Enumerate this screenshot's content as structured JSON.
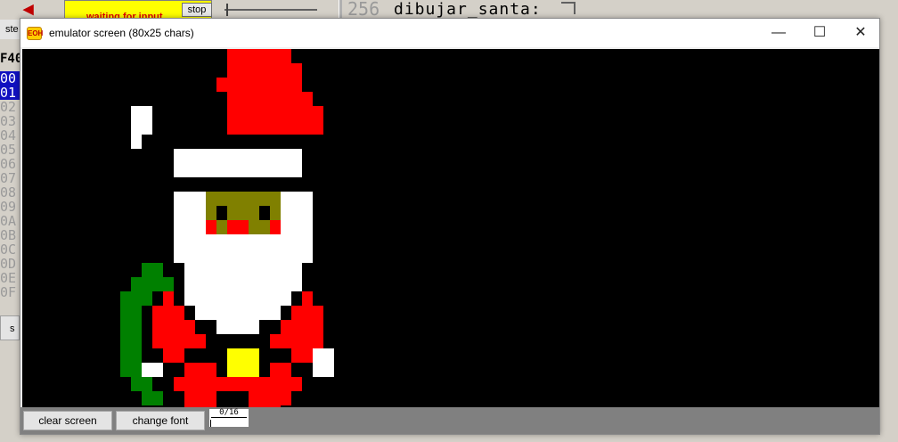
{
  "bg_app": {
    "status_text": "waiting for input",
    "stop_label": "stop",
    "line_number": "256",
    "code_label": "dibujar_santa:",
    "step_label": "ste",
    "mem_header": "F40",
    "mem_rows": [
      "00",
      "01",
      "02",
      "03",
      "04",
      "05",
      "06",
      "07",
      "08",
      "09",
      "0A",
      "0B",
      "0C",
      "0D",
      "0E",
      "0F"
    ],
    "bottom_left_label": "s"
  },
  "window": {
    "title": "emulator screen (80x25 chars)",
    "icon_label": "ЕОН",
    "minimize_glyph": "—",
    "maximize_glyph": "☐",
    "close_glyph": "✕"
  },
  "buttons": {
    "clear_screen": "clear screen",
    "change_font": "change font"
  },
  "counter": "0/16",
  "santa_sprite": {
    "colors": {
      "R": "#ff0000",
      "W": "#ffffff",
      "O": "#808000",
      "K": "#000000",
      "Y": "#ffff00",
      "G": "#008000"
    },
    "rows": [
      "...........RRRRRR.........",
      "...........RRRRRRR........",
      "..........RRRRRRRR........",
      "...........RRRRRRRR.......",
      "..WW.......RRRRRRRRR......",
      "..WW.......RRRRRRRRR......",
      "..W.......................",
      "......WWWWWWWWWWWW........",
      "......WWWWWWWWWWWW........",
      "..........................",
      "......WWWOOOOOOOWWW.......",
      "......WWWOKOOOKOWWW.......",
      "......WWWRORROORWWW.......",
      "......WWWWWWWWWWWWW.......",
      "......WWWWWWWWWWWWW.......",
      "...GG..WWWWWWWWWWW........",
      "..GGGG.WWWWWWWWWWW........",
      ".GGGKRKWWWWWWWWWWKRK......",
      ".GGKRRRKWWWWWWWWKRRRK.....",
      ".GGKRRRRKKWWWWKKRRRRK.....",
      ".GGKRRRRRKKKKKKRRRRRK.....",
      ".GGKKRRKKKKYYYKKKRRWW.....",
      ".GGWWKKRRRKYYYKRRKKWW.....",
      "..GG.KRRRRRRRRRRRRK.......",
      "...GG.KRRRKKKRRRRK........",
      ".......RRRKKKRRRK........."
    ]
  }
}
